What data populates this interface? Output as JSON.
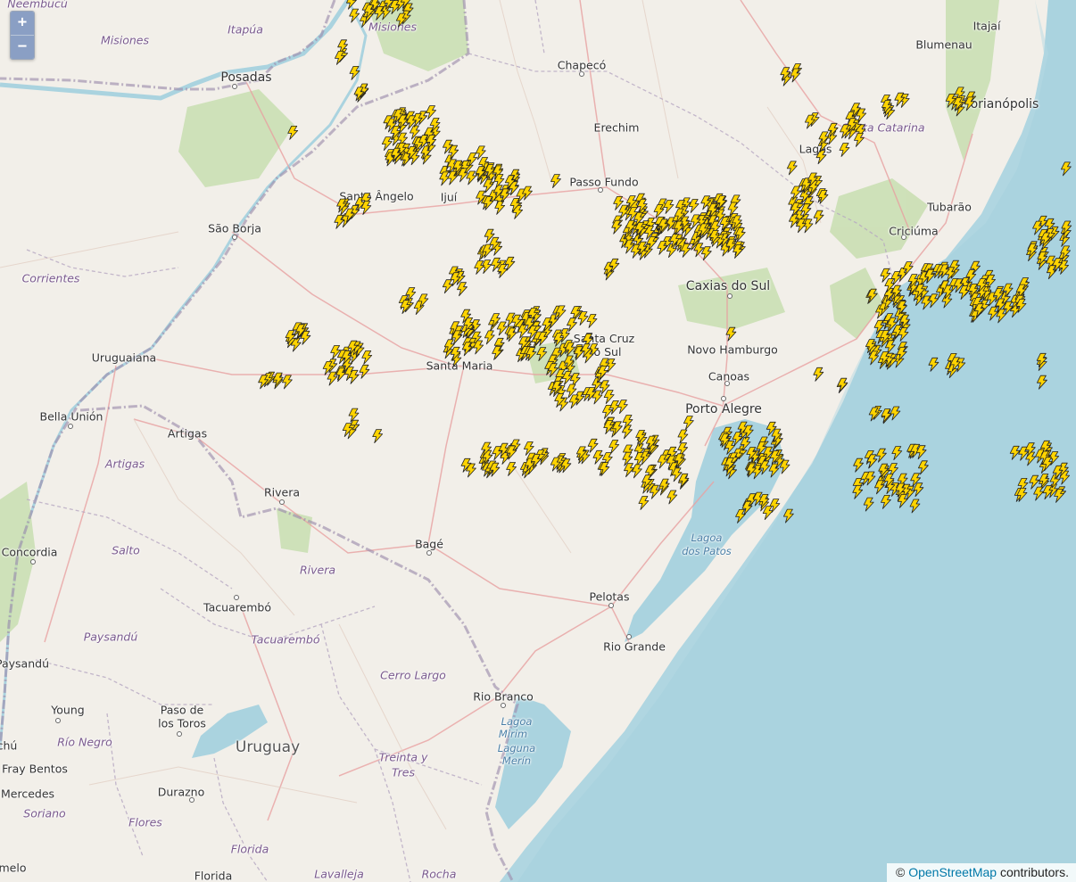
{
  "zoom": {
    "in_label": "+",
    "out_label": "−"
  },
  "attribution": {
    "prefix": "©",
    "link_text": "OpenStreetMap",
    "suffix": "contributors."
  },
  "colors": {
    "land": "#f2efe9",
    "sea": "#aad3df",
    "lake": "#aad3df",
    "border": "#9e8fae",
    "road_main": "#f0a8a8",
    "road_minor": "#e9c7b8",
    "forest": "#c8deb0",
    "strike_fill": "#ffd400",
    "strike_stroke": "#222222"
  },
  "labels": {
    "neembucu": "Ñeembucú",
    "itapua": "Itapúa",
    "misiones_ar": "Misiones",
    "misiones_py": "Misiones",
    "posadas": "Posadas",
    "chapeco": "Chapecó",
    "blumenau": "Blumenau",
    "itajai": "Itajaí",
    "florianopolis": "Florianópolis",
    "erechim": "Erechim",
    "lages": "Lages",
    "santa_catarina": "Santa Catarina",
    "passo_fundo": "Passo Fundo",
    "santo_angelo": "Santo Ângelo",
    "ijui": "Ijuí",
    "sao_borja": "São Borja",
    "tubarao": "Tubarão",
    "criciuma": "Criciúma",
    "corrientes": "Corrientes",
    "caxias_do_sul": "Caxias do Sul",
    "uruguaiana": "Uruguaiana",
    "santa_cruz_do_sul": "Santa Cruz do Sul",
    "novo_hamburgo": "Novo Hamburgo",
    "santa_maria": "Santa Maria",
    "canoas": "Canoas",
    "porto_alegre": "Porto Alegre",
    "bella_union": "Bella Unión",
    "artigas_city": "Artigas",
    "artigas_dept": "Artigas",
    "rivera_city": "Rivera",
    "rivera_dept": "Rivera",
    "salto": "Salto",
    "concordia": "Concordia",
    "bage": "Bagé",
    "lagoa_dos_patos_1": "Lagoa",
    "lagoa_dos_patos_2": "dos Patos",
    "tacuarembo_city": "Tacuarembó",
    "tacuarembo_dept": "Tacuarembó",
    "paysandu_dept": "Paysandú",
    "paysandu_city": "Paysandú",
    "pelotas": "Pelotas",
    "rio_grande": "Rio Grande",
    "cerro_largo": "Cerro Largo",
    "young": "Young",
    "paso_de_los_toros_1": "Paso de",
    "paso_de_los_toros_2": "los Toros",
    "rio_branco": "Rio Branco",
    "rio_negro": "Río Negro",
    "uruguay": "Uruguay",
    "lagoa_mirim_1": "Lagoa",
    "lagoa_mirim_2": "Mirim",
    "lagoa_mirim_3": "Laguna",
    "lagoa_mirim_4": "Merín",
    "treinta_y_tres_1": "Treinta y",
    "treinta_y_tres_2": "Tres",
    "fray_bentos": "Fray Bentos",
    "mercedes": "Mercedes",
    "durazno": "Durazno",
    "soriano": "Soriano",
    "flores": "Flores",
    "florida_dept": "Florida",
    "florida_city": "Florida",
    "lavalleja": "Lavalleja",
    "rocha": "Rocha",
    "chu": "chú",
    "melo": "melo"
  }
}
